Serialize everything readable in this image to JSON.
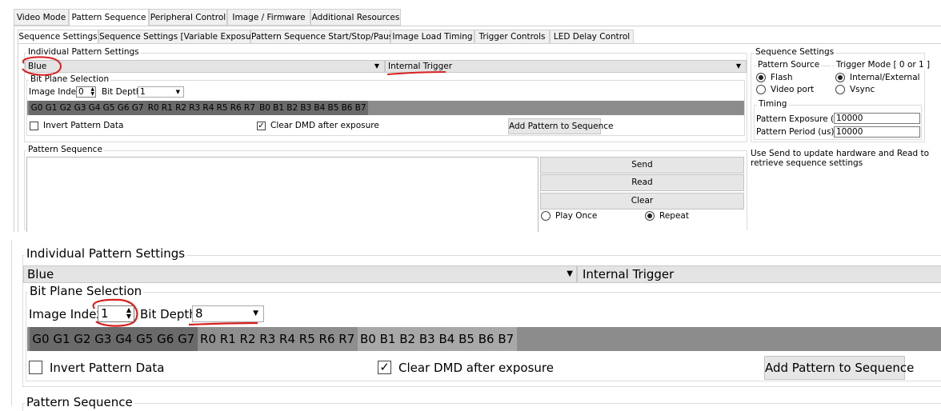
{
  "main_tabs": [
    "Video Mode",
    "Pattern Sequence",
    "Peripheral Control",
    "Image / Firmware",
    "Additional Resources"
  ],
  "sub_tabs": [
    "Sequence Settings",
    "Sequence Settings [Variable Exposure]",
    "Pattern Sequence Start/Stop/Pause",
    "Image Load Timing",
    "Trigger Controls",
    "LED Delay Control"
  ],
  "individual": {
    "group_title": "Individual Pattern Settings",
    "color_value": "Blue",
    "trigger_value": "Internal Trigger",
    "bitplane_title": "Bit Plane Selection",
    "image_index_label": "Image Index",
    "image_index_value_top": "0",
    "image_index_value_zoom": "1",
    "bit_depth_label": "Bit Depth",
    "bit_depth_value_top": "1",
    "bit_depth_value_zoom": "8",
    "green_bits": [
      "G0",
      "G1",
      "G2",
      "G3",
      "G4",
      "G5",
      "G6",
      "G7"
    ],
    "red_bits": [
      "R0",
      "R1",
      "R2",
      "R3",
      "R4",
      "R5",
      "R6",
      "R7"
    ],
    "blue_bits": [
      "B0",
      "B1",
      "B2",
      "B3",
      "B4",
      "B5",
      "B6",
      "B7"
    ],
    "invert_label": "Invert Pattern Data",
    "clear_dmd_label": "Clear DMD after exposure",
    "add_pattern_label": "Add Pattern to Sequence"
  },
  "pattern_sequence": {
    "title": "Pattern Sequence",
    "send_label": "Send",
    "read_label": "Read",
    "clear_label": "Clear",
    "play_once_label": "Play Once",
    "repeat_label": "Repeat"
  },
  "sequence_settings": {
    "title": "Sequence Settings",
    "pattern_source_title": "Pattern Source",
    "flash_label": "Flash",
    "video_port_label": "Video port",
    "trigger_mode_title": "Trigger Mode [ 0 or 1 ]",
    "internal_external_label": "Internal/External",
    "vsync_label": "Vsync",
    "timing_title": "Timing",
    "exposure_label": "Pattern Exposure (us)",
    "exposure_value": "10000",
    "period_label": "Pattern Period (us)",
    "period_value": "10000",
    "help_text_line1": "Use Send to update hardware and Read to",
    "help_text_line2": "retrieve sequence settings"
  },
  "colors": {
    "annotation": "#d62020"
  }
}
